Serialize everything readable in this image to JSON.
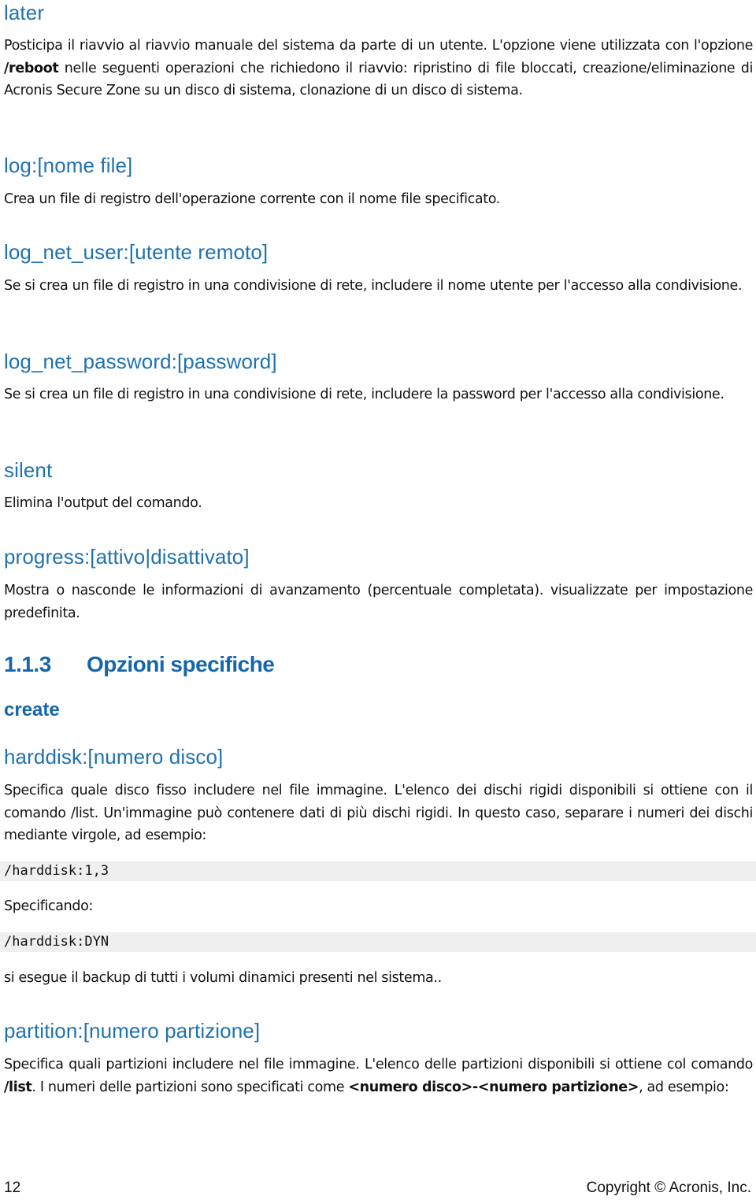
{
  "sections": {
    "later": {
      "heading": "later",
      "text_parts": [
        "Posticipa il riavvio al riavvio manuale del sistema da parte di un utente. L'opzione viene utilizzata con l'opzione ",
        "/reboot",
        " nelle seguenti operazioni che richiedono il riavvio: ripristino di file bloccati, creazione/eliminazione di Acronis Secure Zone su un disco di sistema, clonazione di un disco di sistema."
      ]
    },
    "log": {
      "heading": "log:[nome file]",
      "text": "Crea un file di registro dell'operazione corrente con il nome file specificato."
    },
    "log_net_user": {
      "heading": "log_net_user:[utente remoto]",
      "text": "Se si crea un file di registro in una condivisione di rete, includere il nome utente per l'accesso alla condivisione."
    },
    "log_net_password": {
      "heading": "log_net_password:[password]",
      "text": "Se si crea un file di registro in una condivisione di rete, includere la password per l'accesso alla condivisione."
    },
    "silent": {
      "heading": "silent",
      "text": "Elimina l'output del comando."
    },
    "progress": {
      "heading": "progress:[attivo|disattivato]",
      "text": "Mostra o nasconde le informazioni di avanzamento (percentuale completata). visualizzate per impostazione predefinita."
    }
  },
  "chapter": {
    "number": "1.1.3",
    "title": "Opzioni specifiche",
    "subheading": "create"
  },
  "harddisk": {
    "heading": "harddisk:[numero disco]",
    "text": "Specifica quale disco fisso includere nel file immagine. L'elenco dei dischi rigidi disponibili si ottiene con il comando /list. Un'immagine può contenere dati di più dischi rigidi. In questo caso, separare i numeri dei dischi mediante virgole, ad esempio:",
    "code_example_1": "/harddisk:1,3",
    "specifying_label": "Specificando:",
    "code_example_2": "/harddisk:DYN",
    "dyn_text": "si esegue il backup di tutti i volumi dinamici presenti nel sistema.."
  },
  "partition": {
    "heading": "partition:[numero partizione]",
    "text_parts": [
      "Specifica quali partizioni includere nel file immagine. L'elenco delle partizioni disponibili si ottiene col comando ",
      "/list",
      ". I numeri delle partizioni sono specificati come ",
      "<numero disco>-<numero partizione>",
      ", ad esempio:"
    ]
  },
  "footer": {
    "page_number": "12",
    "copyright": "Copyright © Acronis, Inc."
  }
}
